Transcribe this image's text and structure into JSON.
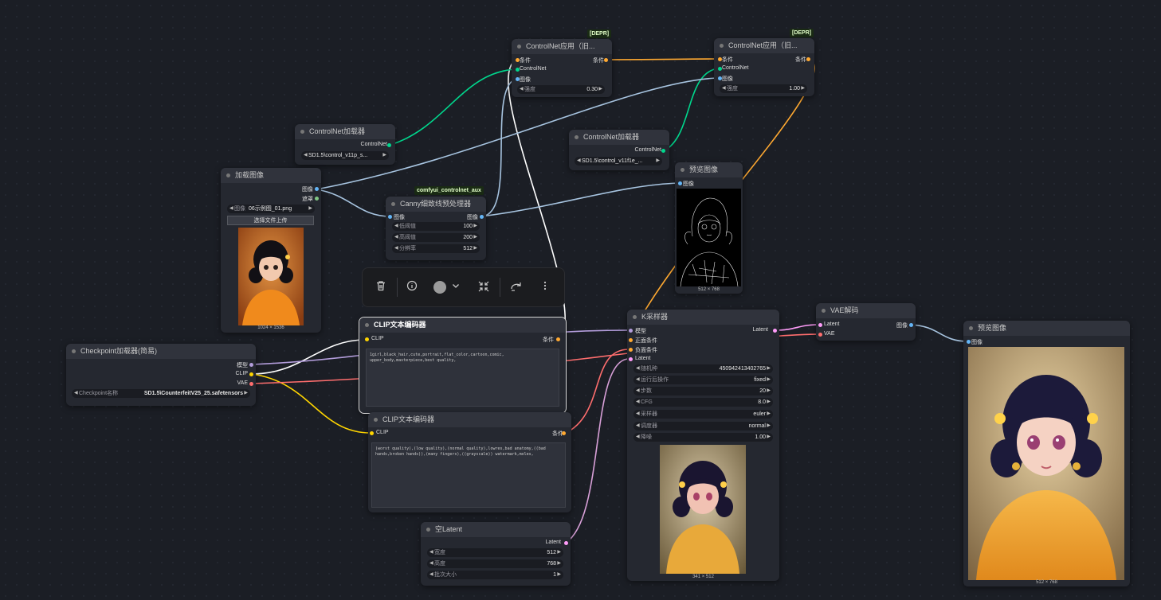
{
  "colors": {
    "canvas": "#1b1e25",
    "node_bg": "#252830",
    "title_bg": "#30333c",
    "clip": "#ffd500",
    "model": "#b39ddb",
    "vae": "#ff6e6e",
    "conditioning": "#ffa931",
    "image": "#64b5f6",
    "latent": "#ff9cf9",
    "controlnet": "#00d78d",
    "mask": "#81c784"
  },
  "nodes": {
    "cn_apply_1": {
      "title": "ControlNet应用（旧...",
      "tag": "[DEPR]",
      "inputs": [
        "条件",
        "ControlNet",
        "图像"
      ],
      "output": "条件",
      "strength": {
        "label": "强度",
        "value": "0.30"
      }
    },
    "cn_apply_2": {
      "title": "ControlNet应用（旧...",
      "tag": "[DEPR]",
      "inputs": [
        "条件",
        "ControlNet",
        "图像"
      ],
      "output": "条件",
      "strength": {
        "label": "强度",
        "value": "1.00"
      }
    },
    "cn_loader_1": {
      "title": "ControlNet加载器",
      "output": "ControlNet",
      "model": "SD1.5\\control_v11p_s..."
    },
    "cn_loader_2": {
      "title": "ControlNet加载器",
      "output": "ControlNet",
      "model": "SD1.5\\control_v11f1e_..."
    },
    "load_image": {
      "title": "加载图像",
      "outputs": [
        "图像",
        "遮罩"
      ],
      "image": {
        "label": "图像",
        "value": "06示例图_01.png"
      },
      "upload": "选择文件上传",
      "caption": "1024 × 1536"
    },
    "canny": {
      "title": "Canny细致线预处理器",
      "tag": "comfyui_controlnet_aux",
      "input": "图像",
      "output": "图像",
      "widgets": [
        {
          "label": "低阈值",
          "value": "100"
        },
        {
          "label": "高阈值",
          "value": "200"
        },
        {
          "label": "分辨率",
          "value": "512"
        }
      ]
    },
    "preview_1": {
      "title": "预览图像",
      "input": "图像",
      "caption": "512 × 768"
    },
    "clip_pos": {
      "title": "CLIP文本编码器",
      "input": "CLIP",
      "output": "条件",
      "text": "1girl,black_hair,cute,portrait,flat_color,cartoon,comic,\nupper_body,masterpiece,best quality,"
    },
    "clip_neg": {
      "title": "CLIP文本编码器",
      "input": "CLIP",
      "output": "条件",
      "text": "(worst quality),(low quality),(normal quality),lowres,bad anatomy,((bad hands,broken hands)),(many fingers),((grayscale)) watermark,moles,"
    },
    "checkpoint": {
      "title": "Checkpoint加载器(简易)",
      "outputs": [
        "模型",
        "CLIP",
        "VAE"
      ],
      "ckpt": {
        "label": "Checkpoint名称",
        "value": "SD1.5\\CounterfeitV25_25.safetensors"
      }
    },
    "ksampler": {
      "title": "K采样器",
      "inputs": [
        "模型",
        "正面条件",
        "负面条件",
        "Latent"
      ],
      "output": "Latent",
      "widgets": [
        {
          "label": "随机种",
          "value": "450942413402765"
        },
        {
          "label": "运行后操作",
          "value": "fixed"
        },
        {
          "label": "步数",
          "value": "20"
        },
        {
          "label": "CFG",
          "value": "8.0"
        },
        {
          "label": "采样器",
          "value": "euler"
        },
        {
          "label": "调度器",
          "value": "normal"
        },
        {
          "label": "降噪",
          "value": "1.00"
        }
      ],
      "caption": "341 × 512"
    },
    "vae_decode": {
      "title": "VAE解码",
      "inputs": [
        "Latent",
        "VAE"
      ],
      "output": "图像"
    },
    "preview_2": {
      "title": "预览图像",
      "input": "图像",
      "caption": "512 × 768"
    },
    "empty_latent": {
      "title": "空Latent",
      "output": "Latent",
      "widgets": [
        {
          "label": "宽度",
          "value": "512"
        },
        {
          "label": "高度",
          "value": "768"
        },
        {
          "label": "批次大小",
          "value": "1"
        }
      ]
    }
  },
  "toolbar": {
    "icons": [
      "trash-icon",
      "info-icon",
      "color-icon",
      "chevron-down-icon",
      "collapse-icon",
      "bypass-icon",
      "more-icon"
    ]
  }
}
